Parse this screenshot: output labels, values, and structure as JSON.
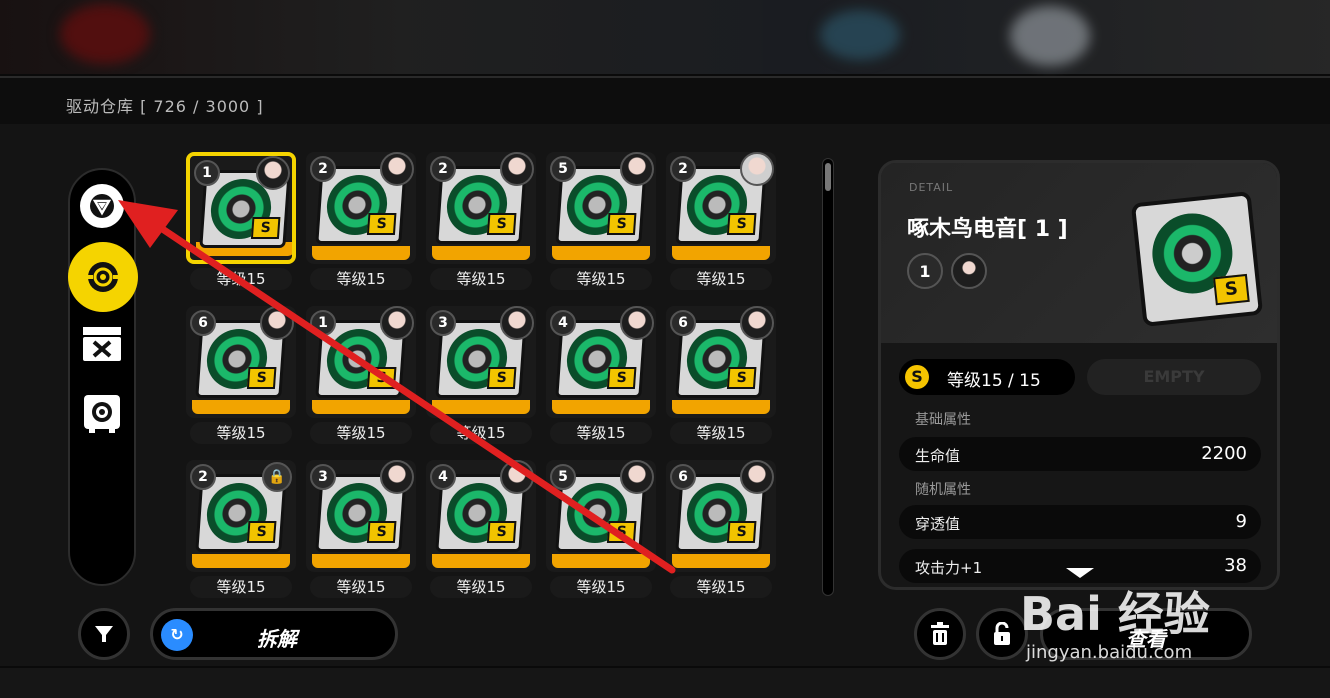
{
  "header": {
    "title": "驱动仓库 [ 726 / 3000 ]"
  },
  "side_bar": {
    "items": [
      {
        "icon": "triangle-sigil-icon"
      },
      {
        "icon": "disk-slot-icon"
      },
      {
        "icon": "crossed-tools-icon"
      },
      {
        "icon": "safe-icon"
      }
    ]
  },
  "grid": {
    "rows": [
      [
        {
          "num": "1",
          "level": "等级15",
          "avatar": "dark",
          "selected": true,
          "lock": false
        },
        {
          "num": "2",
          "level": "等级15",
          "avatar": "dark",
          "selected": false,
          "lock": false
        },
        {
          "num": "2",
          "level": "等级15",
          "avatar": "dark",
          "selected": false,
          "lock": false
        },
        {
          "num": "5",
          "level": "等级15",
          "avatar": "dark",
          "selected": false,
          "lock": false
        },
        {
          "num": "2",
          "level": "等级15",
          "avatar": "silver",
          "selected": false,
          "lock": false
        }
      ],
      [
        {
          "num": "6",
          "level": "等级15",
          "avatar": "dark",
          "selected": false,
          "lock": false
        },
        {
          "num": "1",
          "level": "等级15",
          "avatar": "dark",
          "selected": false,
          "lock": false
        },
        {
          "num": "3",
          "level": "等级15",
          "avatar": "dark",
          "selected": false,
          "lock": false
        },
        {
          "num": "4",
          "level": "等级15",
          "avatar": "dark",
          "selected": false,
          "lock": false
        },
        {
          "num": "6",
          "level": "等级15",
          "avatar": "dark",
          "selected": false,
          "lock": false
        }
      ],
      [
        {
          "num": "2",
          "level": "等级15",
          "avatar": "",
          "selected": false,
          "lock": true
        },
        {
          "num": "3",
          "level": "等级15",
          "avatar": "dark",
          "selected": false,
          "lock": false
        },
        {
          "num": "4",
          "level": "等级15",
          "avatar": "dark",
          "selected": false,
          "lock": false
        },
        {
          "num": "5",
          "level": "等级15",
          "avatar": "dark",
          "selected": false,
          "lock": false
        },
        {
          "num": "6",
          "level": "等级15",
          "avatar": "dark",
          "selected": false,
          "lock": false
        }
      ]
    ],
    "tag": "S"
  },
  "detail": {
    "eyebrow": "DETAIL",
    "name": "啄木鸟电音[ 1 ]",
    "slot": "1",
    "level": "等级15 / 15",
    "rank_badge": "S",
    "empty_label": "EMPTY",
    "base_label": "基础属性",
    "base_stats": [
      {
        "key": "生命值",
        "value": "2200"
      }
    ],
    "random_label": "随机属性",
    "random_stats": [
      {
        "key": "穿透值",
        "value": "9"
      },
      {
        "key": "攻击力+1",
        "value": "38"
      }
    ]
  },
  "bottom": {
    "filter_icon": "filter-icon",
    "decompose_label": "拆解",
    "decompose_icon": "recycle-icon",
    "trash_icon": "trash-icon",
    "lock_icon": "lock-icon",
    "view_label": "查看"
  },
  "watermark": {
    "big": "Bai 经验",
    "small": "jingyan.baidu.com"
  },
  "colors": {
    "accent": "#f5d400",
    "level_bar": "#f2a400",
    "arrow": "#e02020"
  }
}
